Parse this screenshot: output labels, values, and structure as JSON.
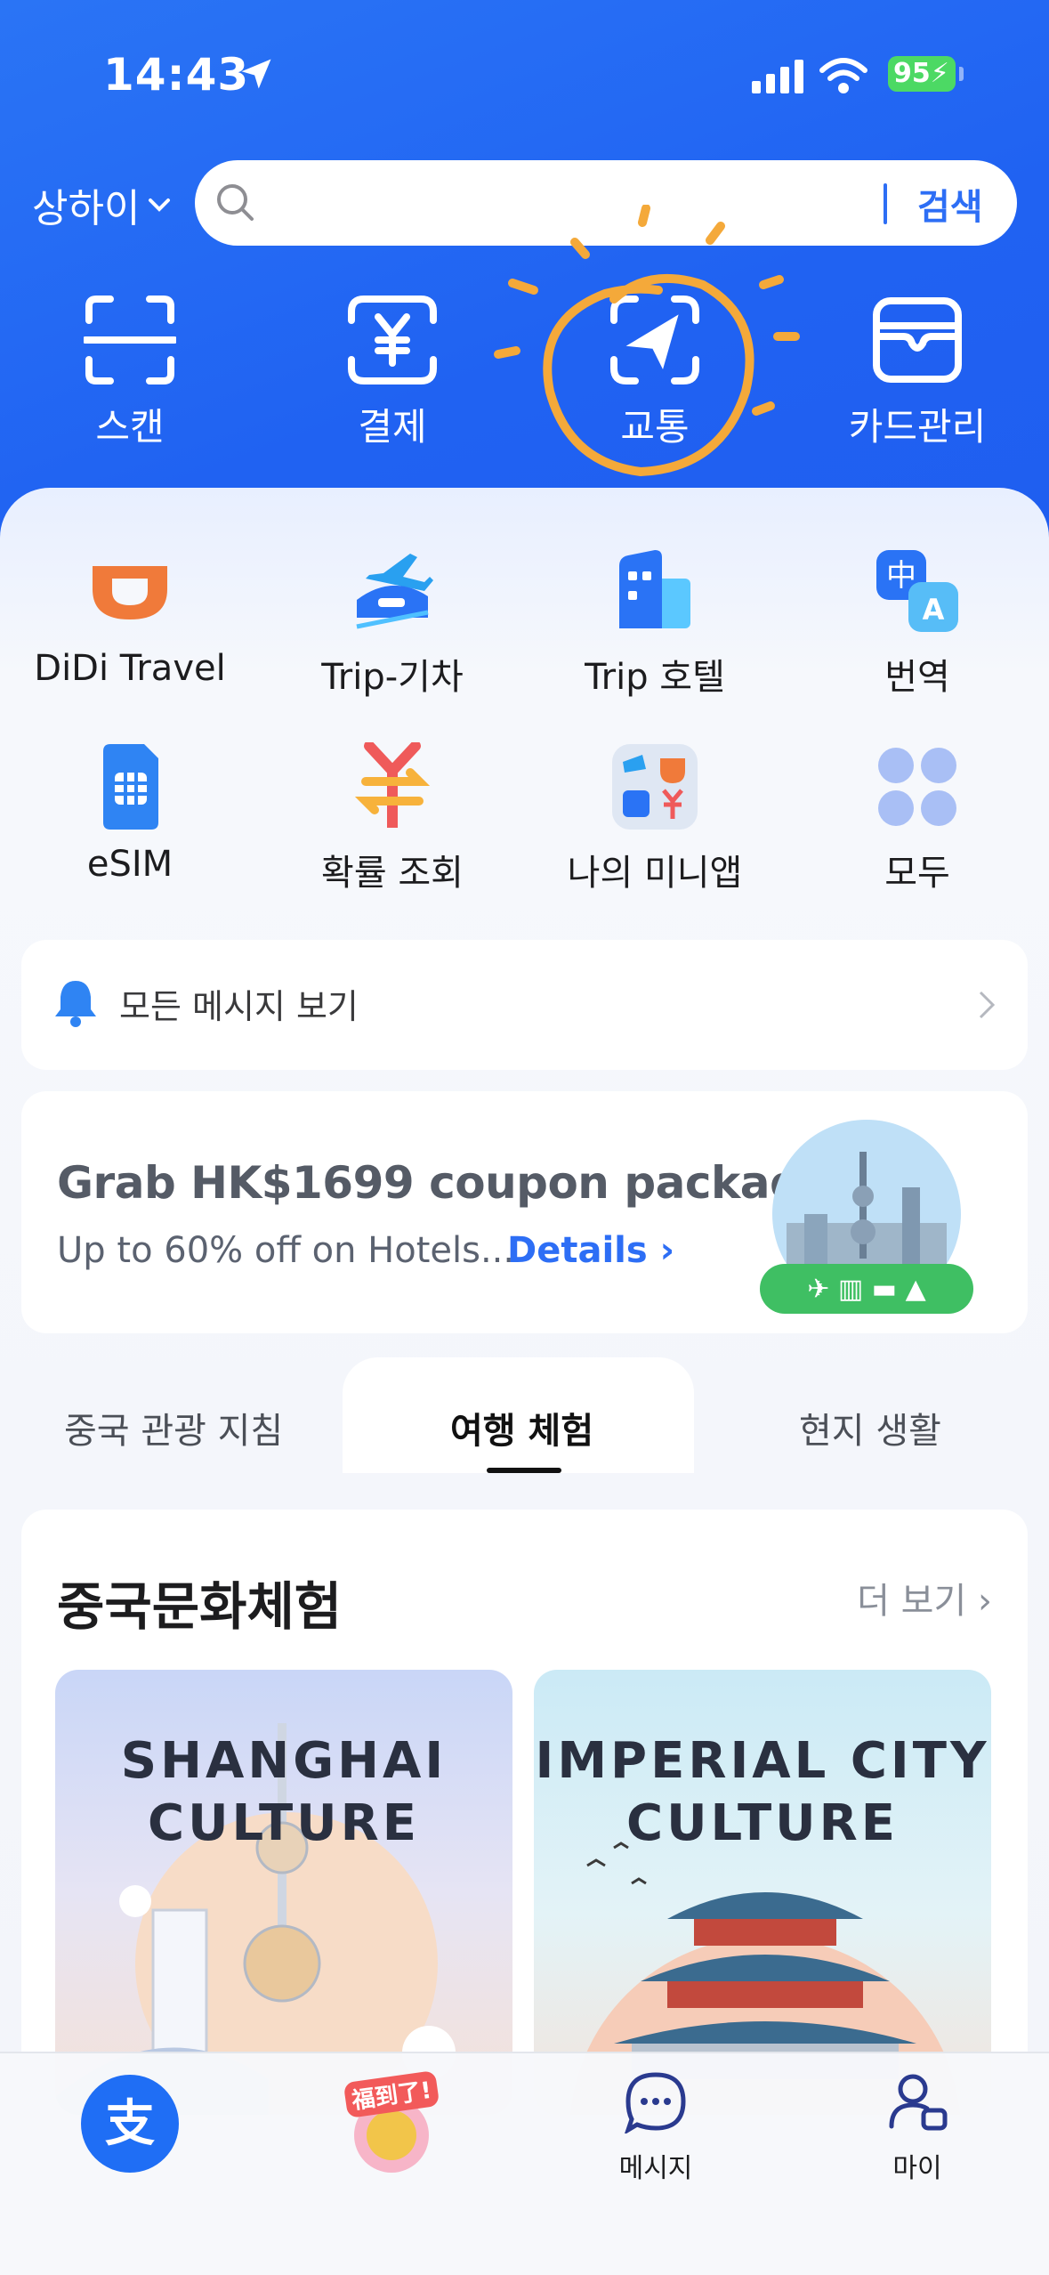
{
  "status_bar": {
    "time": "14:43",
    "battery": "95"
  },
  "header": {
    "city": "상하이",
    "search_placeholder": "",
    "search_button": "검색",
    "quick_actions": [
      {
        "label": "스캔",
        "icon": "scan-icon"
      },
      {
        "label": "결제",
        "icon": "yen-payment-icon"
      },
      {
        "label": "교통",
        "icon": "transport-arrow-icon"
      },
      {
        "label": "카드관리",
        "icon": "card-wallet-icon"
      }
    ]
  },
  "apps": [
    {
      "label": "DiDi Travel",
      "icon": "didi-icon"
    },
    {
      "label": "Trip-기차",
      "icon": "train-icon"
    },
    {
      "label": "Trip 호텔",
      "icon": "hotel-icon"
    },
    {
      "label": "번역",
      "icon": "translate-icon"
    },
    {
      "label": "eSIM",
      "icon": "esim-icon"
    },
    {
      "label": "확률 조회",
      "icon": "exchange-rate-icon"
    },
    {
      "label": "나의 미니앱",
      "icon": "mini-apps-icon"
    },
    {
      "label": "모두",
      "icon": "all-apps-icon"
    }
  ],
  "messages": {
    "label": "모든 메시지 보기"
  },
  "promo": {
    "title": "Grab HK$1699 coupon package",
    "subtitle": "Up to 60% off on Hotels...",
    "link": "Details"
  },
  "tabs": [
    "중국 관광 지침",
    "여행 체험",
    "현지 생활"
  ],
  "culture": {
    "title": "중국문화체험",
    "more": "더 보기",
    "tiles": [
      {
        "line1": "SHANGHAI",
        "line2": "CULTURE"
      },
      {
        "line1": "IMPERIAL CITY",
        "line2": "CULTURE"
      }
    ]
  },
  "nav": {
    "messages": "메시지",
    "my": "마이",
    "home_glyph": "支",
    "promo_glyph": "福到了!"
  },
  "colors": {
    "brand": "#1F62F2",
    "accent_orange": "#F4A93A",
    "didi_orange": "#F07A3A"
  }
}
